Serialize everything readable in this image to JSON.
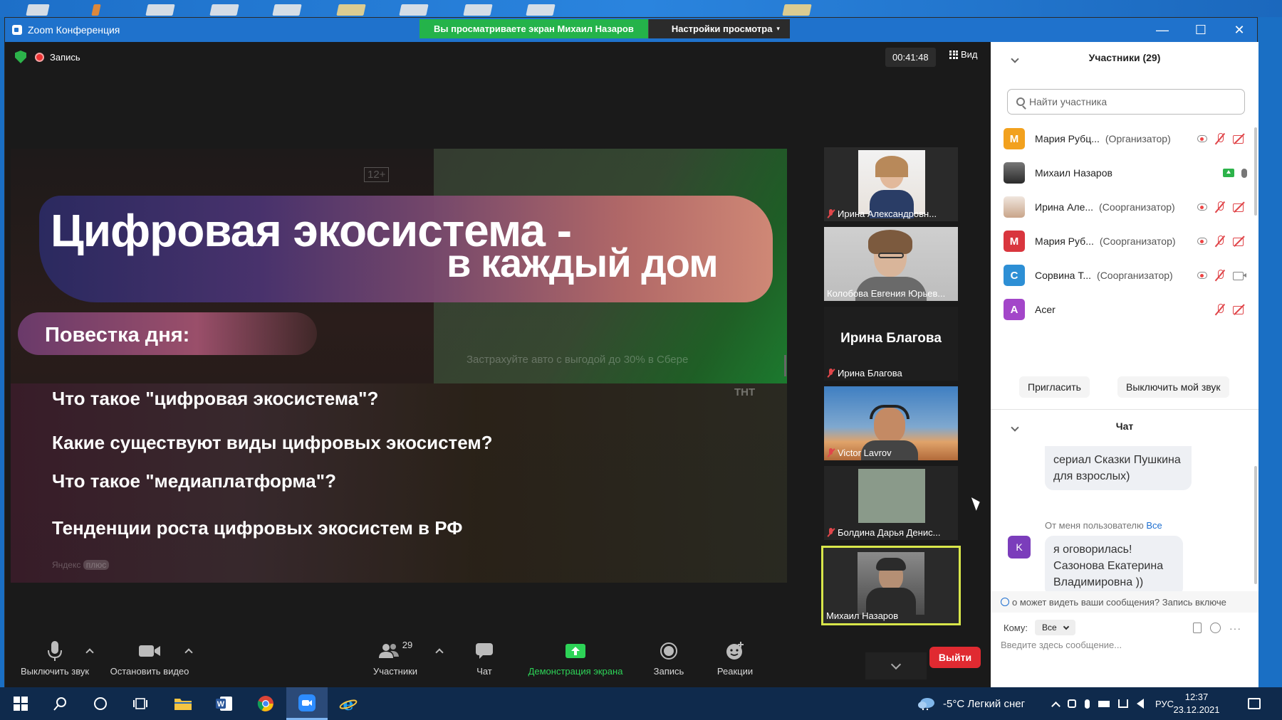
{
  "window": {
    "title": "Zoom Конференция",
    "share_banner": "Вы просматриваете экран Михаил Назаров",
    "view_settings": "Настройки просмотра"
  },
  "meeting": {
    "recording_label": "Запись",
    "timer": "00:41:48",
    "view_label": "Вид"
  },
  "slide": {
    "title_line1": "Цифровая экосистема -",
    "title_line2": "в каждый дом",
    "agenda": "Повестка дня:",
    "items": [
      "Что такое \"цифровая экосистема\"?",
      "Какие существуют виды цифровых экосистем?",
      "Что такое \"медиаплатформа\"?",
      "Тенденции роста цифровых экосистем в РФ"
    ],
    "bg_rating": "12+",
    "bg_ad": "Застрахуйте авто с выгодой до 30% в Сбере",
    "bg_brand": "Яндекс",
    "bg_brand2": "плюс",
    "bg_tnt": "ТНТ"
  },
  "thumbnails": [
    {
      "name": "Ирина Александровн...",
      "muted": true
    },
    {
      "name": "Колобова Евгения Юрьев...",
      "muted": false
    },
    {
      "name": "Ирина Благова",
      "muted": true,
      "big_name": "Ирина Благова"
    },
    {
      "name": "Victor Lavrov",
      "muted": true
    },
    {
      "name": "Болдина Дарья Денис...",
      "muted": true
    },
    {
      "name": "Михаил Назаров",
      "muted": false
    }
  ],
  "toolbar": {
    "mute": "Выключить звук",
    "video": "Остановить видео",
    "participants": "Участники",
    "participants_count": "29",
    "chat": "Чат",
    "share": "Демонстрация экрана",
    "record": "Запись",
    "reactions": "Реакции",
    "leave": "Выйти"
  },
  "participants_panel": {
    "title": "Участники (29)",
    "search_placeholder": "Найти участника",
    "list": [
      {
        "initial": "М",
        "name": "Мария Рубц...",
        "role": "(Организатор)",
        "color": "#f2a11e"
      },
      {
        "initial": "",
        "name": "Михаил Назаров",
        "role": "",
        "color": "#3a3a3a"
      },
      {
        "initial": "",
        "name": "Ирина Але...",
        "role": "(Соорганизатор)",
        "color": "#c9a58a"
      },
      {
        "initial": "М",
        "name": "Мария Руб...",
        "role": "(Соорганизатор)",
        "color": "#d9363e"
      },
      {
        "initial": "С",
        "name": "Сорвина Т...",
        "role": "(Соорганизатор)",
        "color": "#2d8fd5"
      },
      {
        "initial": "A",
        "name": "Acer",
        "role": "",
        "color": "#a346c9"
      }
    ],
    "invite": "Пригласить",
    "mute_me": "Выключить мой звук"
  },
  "chat": {
    "title": "Чат",
    "msg1": "сериал Сказки Пушкина для взрослых)",
    "from_prefix": "От меня пользователю",
    "from_target": "Все",
    "avatar_initial": "K",
    "msg2": "я оговорилась! Сазонова Екатерина Владимировна ))",
    "notice": "о может видеть ваши сообщения? Запись включе",
    "to_label": "Кому:",
    "to_value": "Все",
    "input_placeholder": "Введите здесь сообщение..."
  },
  "taskbar": {
    "weather": "-5°C  Легкий снег",
    "lang": "РУС",
    "time": "12:37",
    "date": "23.12.2021"
  }
}
